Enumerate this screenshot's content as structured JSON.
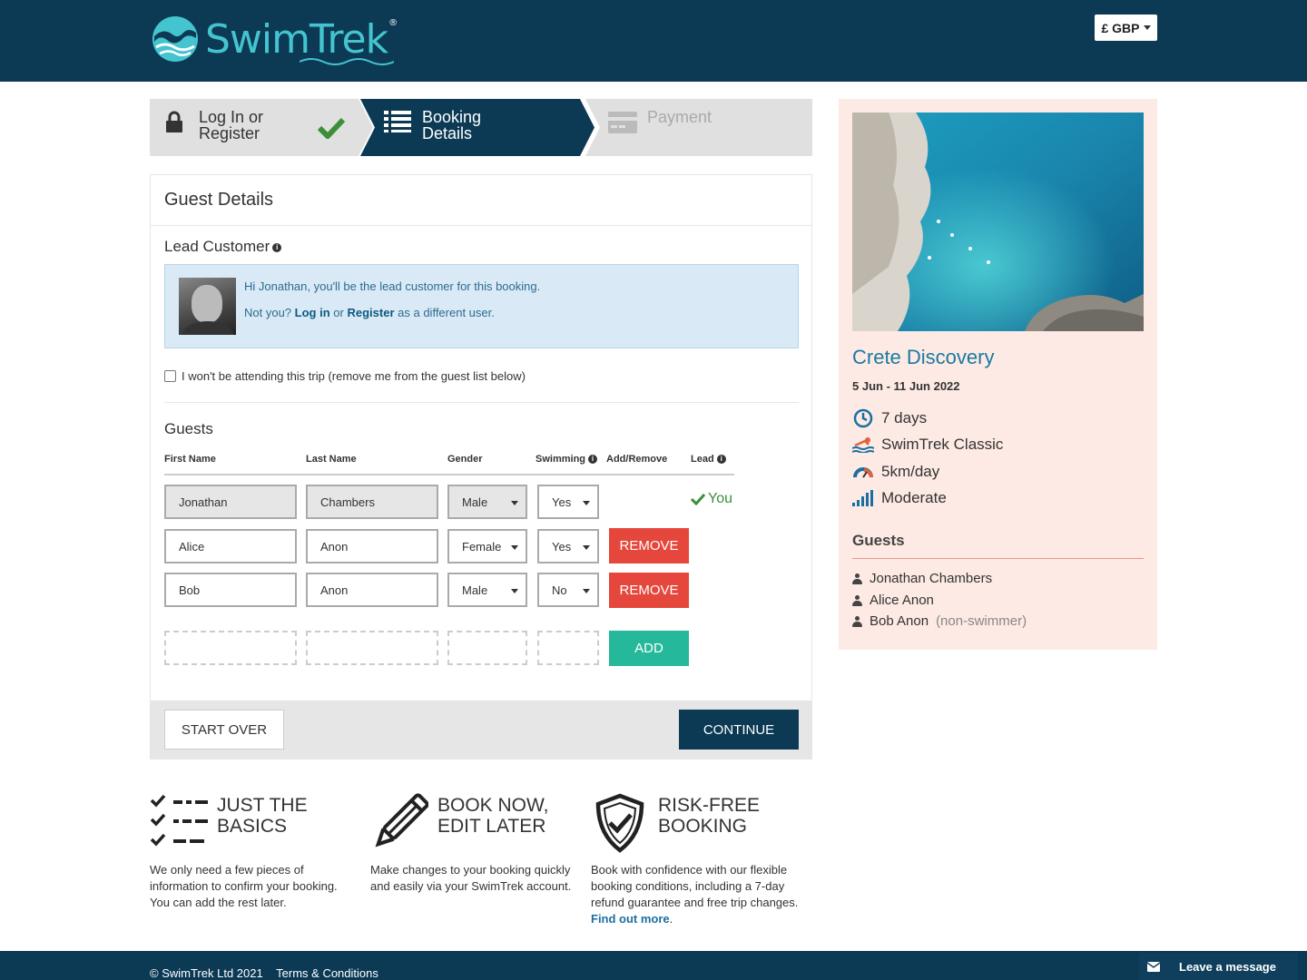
{
  "header": {
    "logo_text": "SwimTrek",
    "logo_reg": "®",
    "currency_label": "£ GBP"
  },
  "steps": [
    {
      "label_line1": "Log In or",
      "label_line2": "Register",
      "state": "done"
    },
    {
      "label_line1": "Booking",
      "label_line2": "Details",
      "state": "active"
    },
    {
      "label_line1": "Payment",
      "label_line2": "",
      "state": "pending"
    }
  ],
  "guest_details": {
    "title": "Guest Details",
    "lead_title": "Lead Customer",
    "lead_greeting": "Hi Jonathan, you'll be the lead customer for this booking.",
    "lead_notyou": "Not you?",
    "lead_login": "Log in",
    "lead_or": "or",
    "lead_register": "Register",
    "lead_different": "as a different user.",
    "not_attending_label": "I won't be attending this trip (remove me from the guest list below)",
    "guests_title": "Guests",
    "columns": {
      "first_name": "First Name",
      "last_name": "Last Name",
      "gender": "Gender",
      "swimming": "Swimming",
      "add_remove": "Add/Remove",
      "lead": "Lead"
    },
    "rows": [
      {
        "first": "Jonathan",
        "last": "Chambers",
        "gender": "Male",
        "swimming": "Yes",
        "lead_label": "You"
      },
      {
        "first": "Alice",
        "last": "Anon",
        "gender": "Female",
        "swimming": "Yes",
        "action": "REMOVE"
      },
      {
        "first": "Bob",
        "last": "Anon",
        "gender": "Male",
        "swimming": "No",
        "action": "REMOVE"
      }
    ],
    "add_label": "ADD",
    "start_over_label": "START OVER",
    "continue_label": "CONTINUE"
  },
  "sidebar": {
    "trip_title": "Crete Discovery",
    "trip_dates": "5 Jun - 11 Jun 2022",
    "features": [
      {
        "icon": "clock-icon",
        "label": "7 days"
      },
      {
        "icon": "swimmer-icon",
        "label": "SwimTrek Classic"
      },
      {
        "icon": "gauge-icon",
        "label": "5km/day"
      },
      {
        "icon": "signal-bars-icon",
        "label": "Moderate"
      }
    ],
    "guests_title": "Guests",
    "guests": [
      {
        "name": "Jonathan Chambers",
        "note": ""
      },
      {
        "name": "Alice Anon",
        "note": ""
      },
      {
        "name": "Bob Anon",
        "note": "(non-swimmer)"
      }
    ]
  },
  "benefits": [
    {
      "icon": "checklist-icon",
      "title_line1": "JUST THE",
      "title_line2": "BASICS",
      "desc": "We only need a few pieces of information to confirm your booking. You can add the rest later.",
      "link": ""
    },
    {
      "icon": "pencil-icon",
      "title_line1": "BOOK NOW,",
      "title_line2": "EDIT LATER",
      "desc": "Make changes to your booking quickly and easily via your SwimTrek account.",
      "link": ""
    },
    {
      "icon": "shield-check-icon",
      "title_line1": "RISK-FREE",
      "title_line2": "BOOKING",
      "desc": "Book with confidence with our flexible booking conditions, including a 7-day refund guarantee and free trip changes.",
      "link": "Find out more"
    }
  ],
  "footer": {
    "copyright": "© SwimTrek Ltd 2021",
    "terms": "Terms & Conditions",
    "leave_message": "Leave a message"
  },
  "colors": {
    "brand_dark": "#0c3a55",
    "brand_teal": "#44c4cf",
    "remove_red": "#e5473c",
    "add_green": "#26b89a",
    "sidebar_bg": "#fdeae4"
  }
}
